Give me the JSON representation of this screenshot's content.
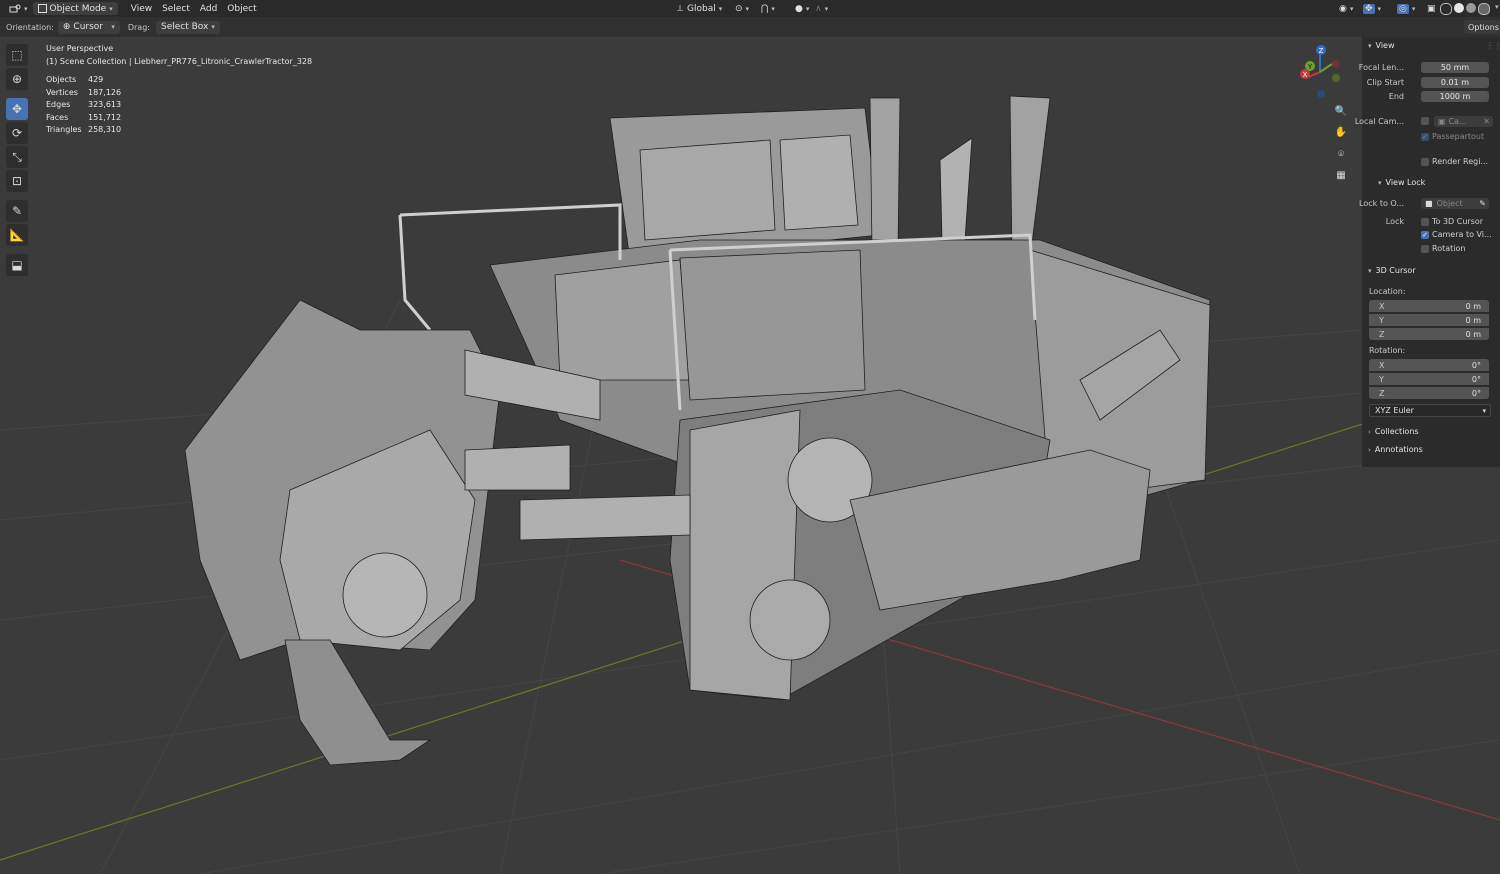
{
  "header": {
    "mode": "Object Mode",
    "menus": [
      "View",
      "Select",
      "Add",
      "Object"
    ],
    "transform_orientation": "Global"
  },
  "tool_settings": {
    "orientation_label": "Orientation:",
    "orientation_value": "Cursor",
    "drag_label": "Drag:",
    "drag_value": "Select Box",
    "options_label": "Options"
  },
  "viewport": {
    "perspective": "User Perspective",
    "collection": "(1) Scene Collection | Liebherr_PR776_Litronic_CrawlerTractor_328",
    "stats": [
      {
        "label": "Objects",
        "value": "429"
      },
      {
        "label": "Vertices",
        "value": "187,126"
      },
      {
        "label": "Edges",
        "value": "323,613"
      },
      {
        "label": "Faces",
        "value": "151,712"
      },
      {
        "label": "Triangles",
        "value": "258,310"
      }
    ],
    "gizmo": {
      "z": "Z",
      "y": "Y",
      "x": "X"
    }
  },
  "npanel": {
    "view_title": "View",
    "focal_label": "Focal Len...",
    "focal_value": "50 mm",
    "clip_start_label": "Clip Start",
    "clip_start_value": "0.01 m",
    "clip_end_label": "End",
    "clip_end_value": "1000 m",
    "local_cam_label": "Local Cam...",
    "local_cam_value": "Ca...",
    "passepartout_label": "Passepartout",
    "render_region_label": "Render Regi...",
    "view_lock_title": "View Lock",
    "lock_to_label": "Lock to O...",
    "lock_to_value": "Object",
    "lock_label": "Lock",
    "to_cursor_label": "To 3D Cursor",
    "camera_to_view_label": "Camera to Vi...",
    "rotation_lock_label": "Rotation",
    "cursor_title": "3D Cursor",
    "location_label": "Location:",
    "loc_x_label": "X",
    "loc_x_value": "0 m",
    "loc_y_label": "Y",
    "loc_y_value": "0 m",
    "loc_z_label": "Z",
    "loc_z_value": "0 m",
    "rotation_label": "Rotation:",
    "rot_x_label": "X",
    "rot_x_value": "0°",
    "rot_y_label": "Y",
    "rot_y_value": "0°",
    "rot_z_label": "Z",
    "rot_z_value": "0°",
    "rotation_mode": "XYZ Euler",
    "collections_title": "Collections",
    "annotations_title": "Annotations"
  }
}
